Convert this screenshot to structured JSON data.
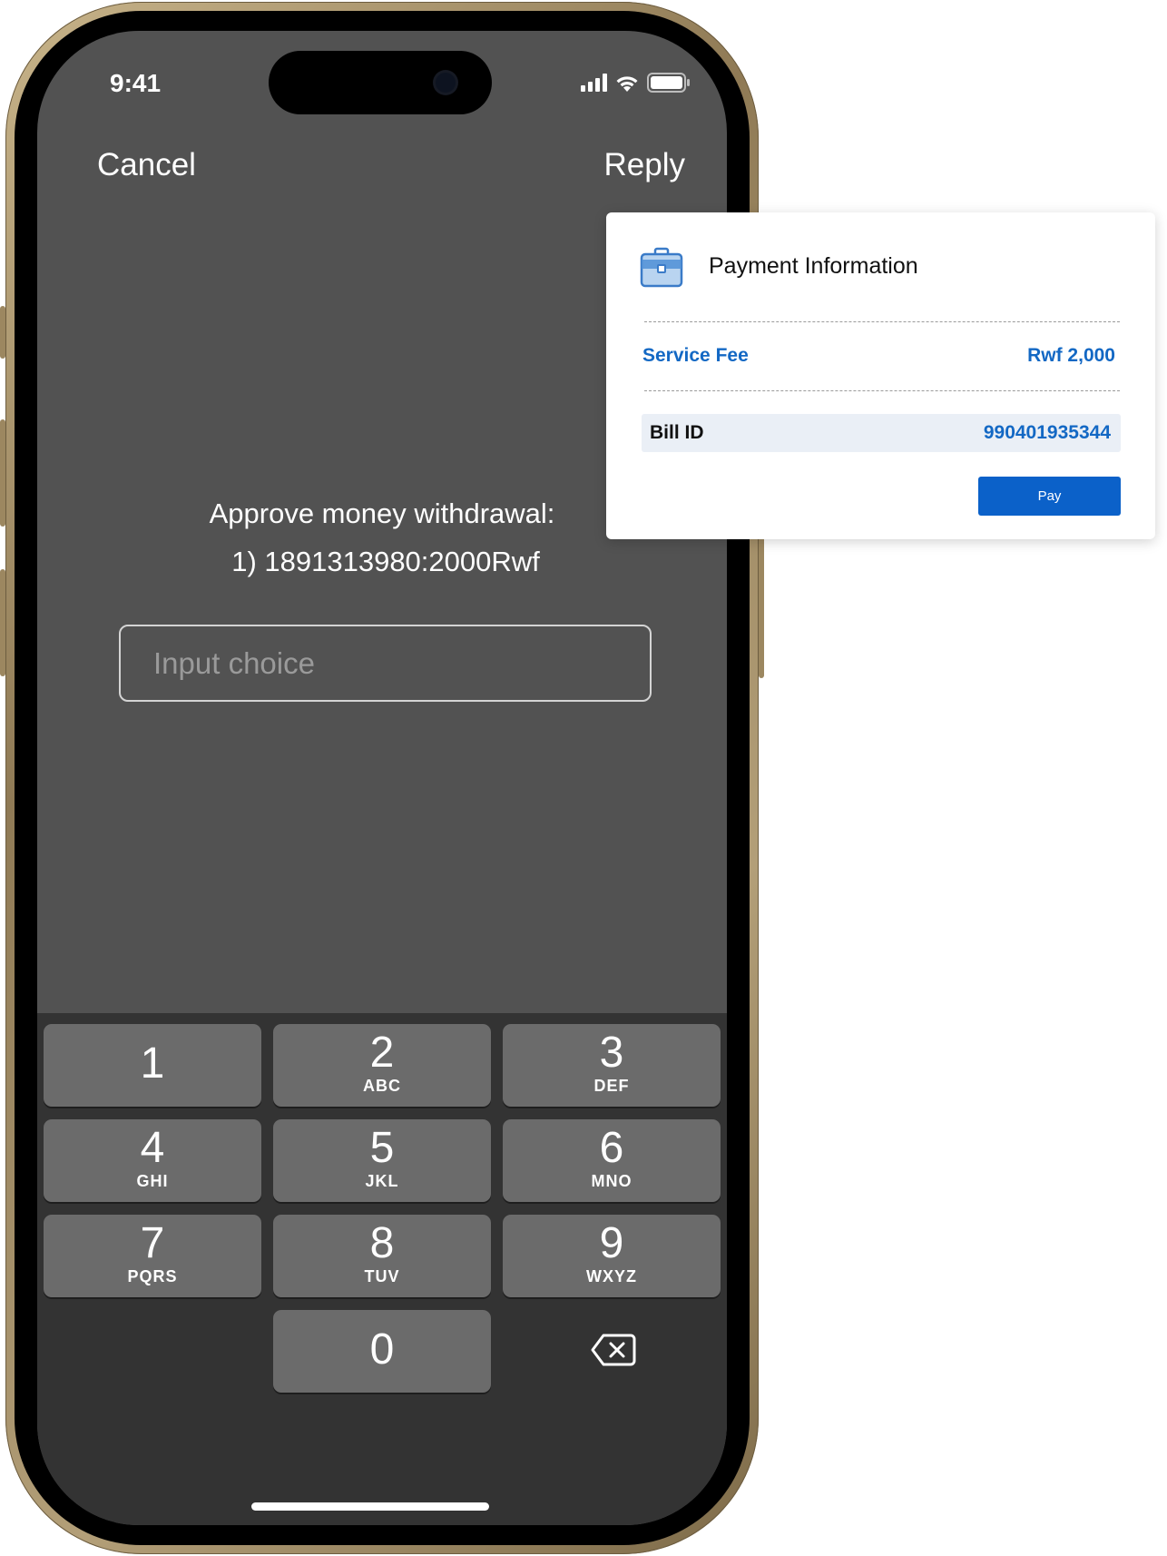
{
  "status": {
    "time": "9:41"
  },
  "nav": {
    "cancel_label": "Cancel",
    "reply_label": "Reply"
  },
  "message": {
    "line1": "Approve money withdrawal:",
    "line2": "1)  1891313980:2000Rwf"
  },
  "input": {
    "placeholder": "Input choice",
    "value": ""
  },
  "keypad": {
    "keys": [
      {
        "num": "1",
        "letters": ""
      },
      {
        "num": "2",
        "letters": "ABC"
      },
      {
        "num": "3",
        "letters": "DEF"
      },
      {
        "num": "4",
        "letters": "GHI"
      },
      {
        "num": "5",
        "letters": "JKL"
      },
      {
        "num": "6",
        "letters": "MNO"
      },
      {
        "num": "7",
        "letters": "PQRS"
      },
      {
        "num": "8",
        "letters": "TUV"
      },
      {
        "num": "9",
        "letters": "WXYZ"
      },
      {
        "num": "0",
        "letters": ""
      }
    ],
    "backspace_icon": "backspace-icon"
  },
  "payment_card": {
    "icon": "briefcase-icon",
    "title": "Payment Information",
    "service_fee_label": "Service Fee",
    "service_fee_value": "Rwf 2,000",
    "bill_id_label": "Bill ID",
    "bill_id_value": "990401935344",
    "pay_label": "Pay",
    "accent_color": "#0b61c9"
  },
  "colors": {
    "screen_bg": "#525252",
    "keypad_bg": "#333333",
    "key_bg": "#6b6b6b",
    "frame_gold": "#b39f78"
  }
}
